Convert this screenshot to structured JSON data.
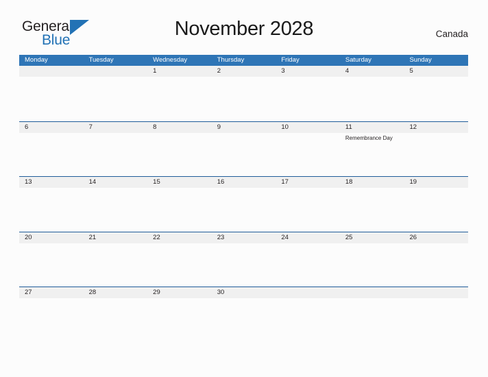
{
  "brand": {
    "name_part1": "General",
    "name_part2": "Blue",
    "flag_icon": "blue-triangle-flag",
    "color_dark": "#231f20",
    "color_blue": "#2272b5"
  },
  "header": {
    "title": "November 2028",
    "country": "Canada"
  },
  "theme": {
    "header_blue": "#2e75b6",
    "row_rule_blue": "#1f5c99",
    "number_band_gray": "#f0f0f0",
    "page_background": "#fcfcfc"
  },
  "calendar": {
    "weekday_headers": [
      "Monday",
      "Tuesday",
      "Wednesday",
      "Thursday",
      "Friday",
      "Saturday",
      "Sunday"
    ],
    "weeks": [
      {
        "days": [
          {
            "number": "",
            "events": []
          },
          {
            "number": "",
            "events": []
          },
          {
            "number": "1",
            "events": []
          },
          {
            "number": "2",
            "events": []
          },
          {
            "number": "3",
            "events": []
          },
          {
            "number": "4",
            "events": []
          },
          {
            "number": "5",
            "events": []
          }
        ]
      },
      {
        "days": [
          {
            "number": "6",
            "events": []
          },
          {
            "number": "7",
            "events": []
          },
          {
            "number": "8",
            "events": []
          },
          {
            "number": "9",
            "events": []
          },
          {
            "number": "10",
            "events": []
          },
          {
            "number": "11",
            "events": [
              "Remembrance Day"
            ]
          },
          {
            "number": "12",
            "events": []
          }
        ]
      },
      {
        "days": [
          {
            "number": "13",
            "events": []
          },
          {
            "number": "14",
            "events": []
          },
          {
            "number": "15",
            "events": []
          },
          {
            "number": "16",
            "events": []
          },
          {
            "number": "17",
            "events": []
          },
          {
            "number": "18",
            "events": []
          },
          {
            "number": "19",
            "events": []
          }
        ]
      },
      {
        "days": [
          {
            "number": "20",
            "events": []
          },
          {
            "number": "21",
            "events": []
          },
          {
            "number": "22",
            "events": []
          },
          {
            "number": "23",
            "events": []
          },
          {
            "number": "24",
            "events": []
          },
          {
            "number": "25",
            "events": []
          },
          {
            "number": "26",
            "events": []
          }
        ]
      },
      {
        "days": [
          {
            "number": "27",
            "events": []
          },
          {
            "number": "28",
            "events": []
          },
          {
            "number": "29",
            "events": []
          },
          {
            "number": "30",
            "events": []
          },
          {
            "number": "",
            "events": []
          },
          {
            "number": "",
            "events": []
          },
          {
            "number": "",
            "events": []
          }
        ]
      }
    ]
  }
}
